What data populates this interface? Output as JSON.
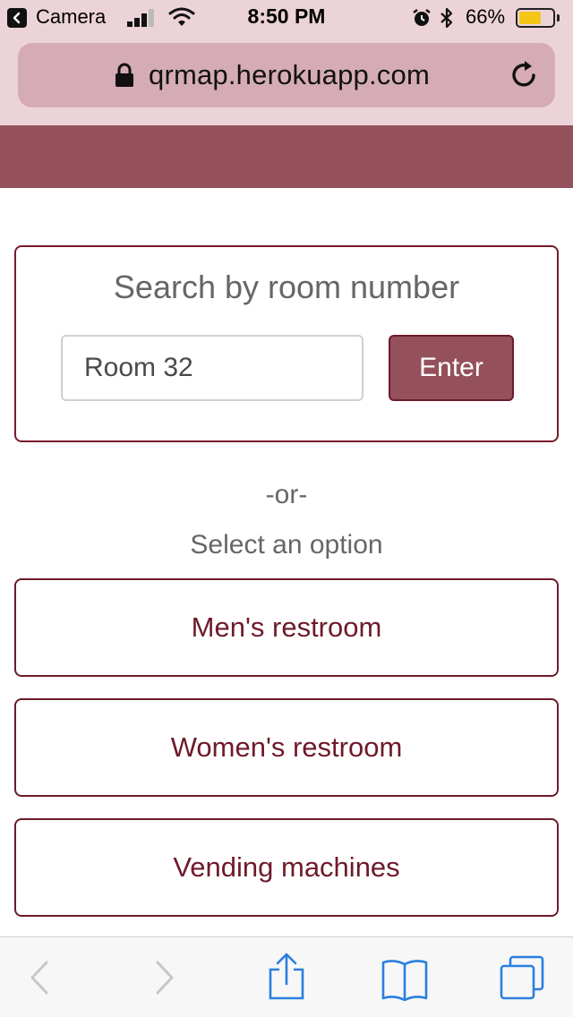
{
  "status_bar": {
    "back_app": "Camera",
    "time": "8:50 PM",
    "battery_percent": "66%",
    "battery_level": 0.66,
    "signal_bars": 3,
    "icons": [
      "back-icon",
      "signal-icon",
      "wifi-icon",
      "alarm-icon",
      "bluetooth-icon",
      "battery-icon"
    ]
  },
  "browser": {
    "url": "qrmap.herokuapp.com",
    "icons": [
      "lock-icon",
      "reload-icon"
    ]
  },
  "search": {
    "title": "Search by room number",
    "input_value": "Room 32",
    "button_label": "Enter"
  },
  "divider": {
    "or_label": "-or-",
    "select_label": "Select an option"
  },
  "options": [
    "Men's restroom",
    "Women's restroom",
    "Vending machines"
  ],
  "toolbar": {
    "icons": [
      "back-arrow-icon",
      "forward-arrow-icon",
      "share-icon",
      "bookmarks-icon",
      "tabs-icon"
    ]
  },
  "colors": {
    "brand": "#94515b",
    "border_accent": "#6e1a2a",
    "chrome_tint": "#ecd3d8",
    "url_field": "#d5acb6"
  }
}
